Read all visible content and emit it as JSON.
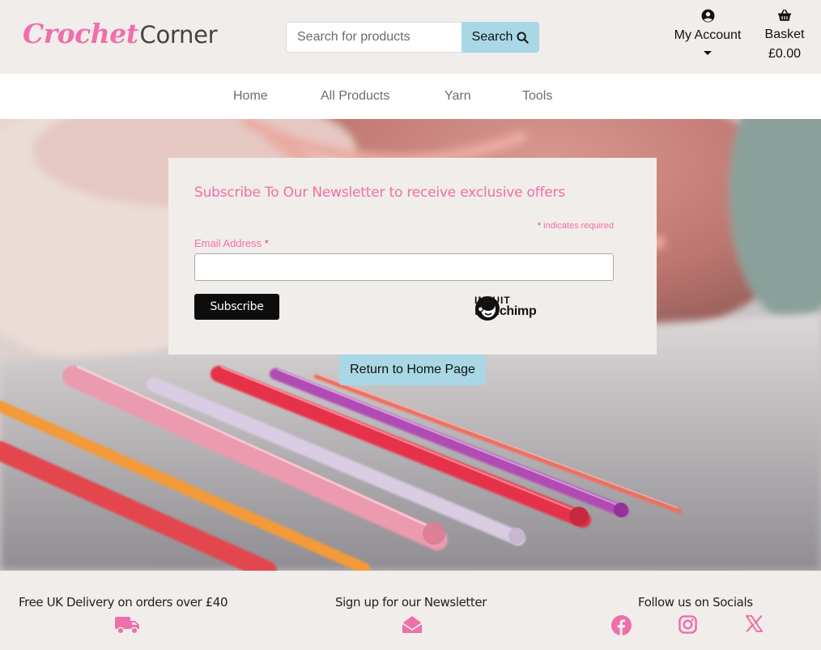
{
  "brand": {
    "logo_script": "Crochet",
    "logo_plain": "Corner"
  },
  "search": {
    "placeholder": "Search for products",
    "button_label": "Search"
  },
  "account": {
    "label": "My Account"
  },
  "basket": {
    "label": "Basket",
    "total": "£0.00"
  },
  "nav": {
    "items": [
      {
        "label": "Home"
      },
      {
        "label": "All Products"
      },
      {
        "label": "Yarn"
      },
      {
        "label": "Tools"
      }
    ]
  },
  "newsletter": {
    "title": "Subscribe To Our Newsletter to receive exclusive offers",
    "required_note": "indicates required",
    "required_marker": "*",
    "email_label": "Email Address",
    "subscribe_label": "Subscribe",
    "badge_top": "INTUIT",
    "badge_bottom": "mailchimp"
  },
  "return_button": "Return to Home Page",
  "footer": {
    "delivery": "Free UK Delivery on orders over £40",
    "newsletter": "Sign up for our Newsletter",
    "socials": "Follow us on Socials"
  },
  "colors": {
    "brand_pink": "#f06ea9",
    "button_blue": "#a9d7e6",
    "background": "#f1edea"
  },
  "icons": [
    "search-icon",
    "user-circle-icon",
    "caret-down-icon",
    "basket-icon",
    "truck-icon",
    "envelope-open-icon",
    "facebook-icon",
    "instagram-icon",
    "x-twitter-icon"
  ]
}
